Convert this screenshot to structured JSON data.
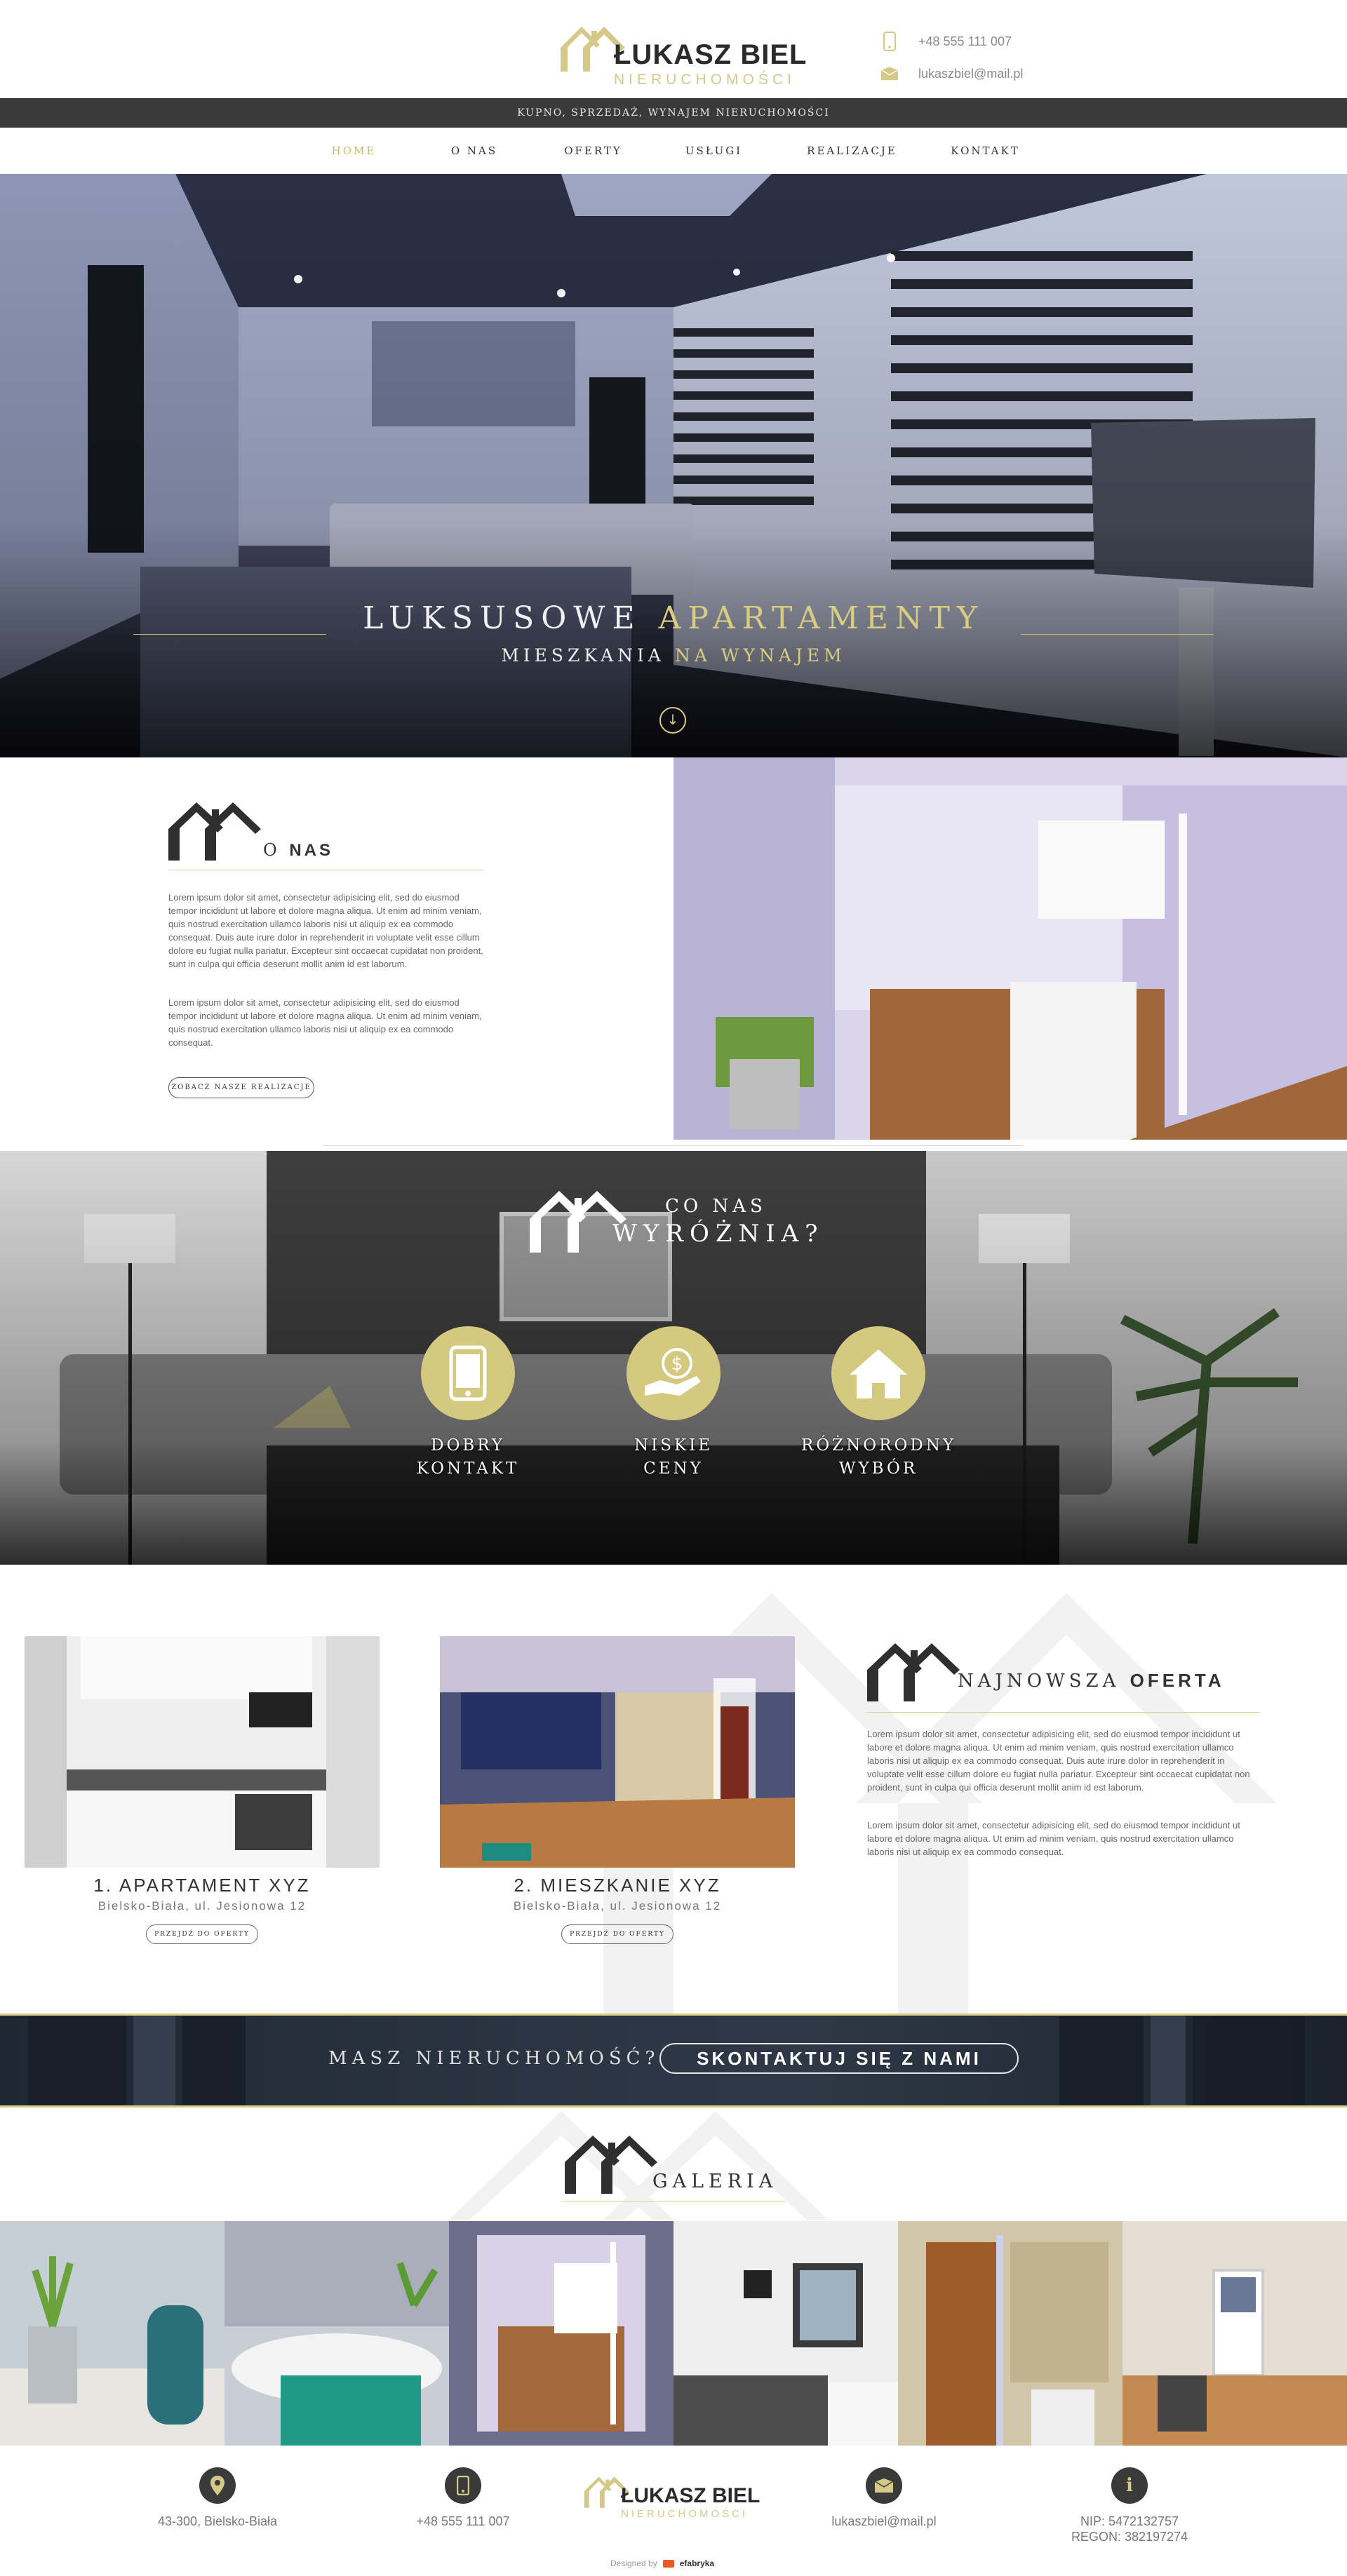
{
  "brand": {
    "name": "ŁUKASZ BIEL",
    "subtitle": "NIERUCHOMOŚCI",
    "accent": "#d9cb7f",
    "dark": "#3a3a3a"
  },
  "header": {
    "phone": "+48 555 111 007",
    "email": "lukaszbiel@mail.pl",
    "tagline": "KUPNO, SPRZEDAŻ, WYNAJEM NIERUCHOMOŚCI"
  },
  "nav": {
    "items": [
      "HOME",
      "O NAS",
      "OFERTY",
      "USŁUGI",
      "REALIZACJE",
      "KONTAKT"
    ],
    "active": "HOME"
  },
  "hero": {
    "title_a": "LUKSUSOWE ",
    "title_b": "APARTAMENTY",
    "sub_a": "MIESZKANIA ",
    "sub_b": "NA WYNAJEM",
    "scroll_icon": "arrow-down-circle-icon"
  },
  "about": {
    "title_a": "O ",
    "title_b": "NAS",
    "p1": "Lorem ipsum dolor sit amet, consectetur adipisicing elit, sed do eiusmod tempor incididunt ut labore et dolore magna aliqua. Ut enim ad minim veniam, quis nostrud exercitation ullamco laboris nisi ut aliquip ex ea commodo consequat. Duis aute irure dolor in reprehenderit in voluptate velit esse cillum dolore eu fugiat nulla pariatur. Excepteur sint occaecat cupidatat non proident, sunt in culpa qui officia deserunt mollit anim id est laborum.",
    "p2": "Lorem ipsum dolor sit amet, consectetur adipisicing elit, sed do eiusmod tempor incididunt ut labore et dolore magna aliqua. Ut enim ad minim veniam, quis nostrud exercitation ullamco laboris nisi ut aliquip ex ea commodo consequat.",
    "button": "ZOBACZ NASZE REALIZACJE"
  },
  "features": {
    "title_a": "CO NAS",
    "title_b": "WYRÓŻNIA?",
    "items": [
      {
        "line1": "DOBRY",
        "line2": "KONTAKT",
        "icon": "smartphone-icon"
      },
      {
        "line1": "NISKIE",
        "line2": "CENY",
        "icon": "money-hand-icon"
      },
      {
        "line1": "RÓŻNORODNY",
        "line2": "WYBÓR",
        "icon": "house-icon"
      }
    ]
  },
  "offers": {
    "items": [
      {
        "title": "1. APARTAMENT XYZ",
        "address": "Bielsko-Biała, ul. Jesionowa 12",
        "button": "PRZEJDŹ DO OFERTY"
      },
      {
        "title": "2. MIESZKANIE XYZ",
        "address": "Bielsko-Biała, ul. Jesionowa 12",
        "button": "PRZEJDŹ DO OFERTY"
      }
    ],
    "news_title_a": "NAJNOWSZA ",
    "news_title_b": "OFERTA",
    "news_p1": "Lorem ipsum dolor sit amet, consectetur adipisicing elit, sed do eiusmod tempor incididunt ut labore et dolore magna aliqua. Ut enim ad minim veniam, quis nostrud exercitation ullamco laboris nisi ut aliquip ex ea commodo consequat. Duis aute irure dolor in reprehenderit in voluptate velit esse cillum dolore eu fugiat nulla pariatur. Excepteur sint occaecat cupidatat non proident, sunt in culpa qui officia deserunt mollit anim id est laborum.",
    "news_p2": "Lorem ipsum dolor sit amet, consectetur adipisicing elit, sed do eiusmod tempor incididunt ut labore et dolore magna aliqua. Ut enim ad minim veniam, quis nostrud exercitation ullamco laboris nisi ut aliquip ex ea commodo consequat."
  },
  "banner": {
    "question": "MASZ NIERUCHOMOŚĆ?",
    "button": "SKONTAKTUJ SIĘ Z NAMI"
  },
  "gallery": {
    "title": "GALERIA"
  },
  "footer": {
    "address": "43-300, Bielsko-Biała",
    "phone": "+48 555 111 007",
    "email": "lukaszbiel@mail.pl",
    "nip": "NIP: 5472132757",
    "regon": "REGON: 382197274",
    "credit_label": "Designed by",
    "credit_brand": "efabryka"
  }
}
